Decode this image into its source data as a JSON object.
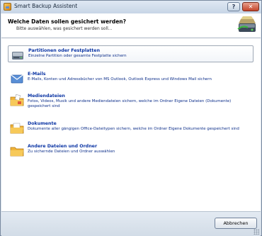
{
  "window": {
    "title": "Smart Backup Assistent",
    "help_label": "?",
    "close_label": "✕"
  },
  "header": {
    "title": "Welche Daten sollen gesichert werden?",
    "subtitle": "Bitte auswählen, was gesichert werden soll..."
  },
  "options": [
    {
      "title": "Partitionen oder Festplatten",
      "description": "Einzelne Partition oder gesamte Festplatte sichern",
      "icon": "hard-drive-icon",
      "selected": true
    },
    {
      "title": "E-Mails",
      "description": "E-Mails, Konten und Adressbücher von MS Outlook, Outlook Express und Windows Mail sichern",
      "icon": "envelope-icon",
      "selected": false
    },
    {
      "title": "Mediendateien",
      "description": "Fotos, Videos, Musik und andere Mediendateien sichern, welche im Ordner Eigene Dateien (Dokumente) gespeichert sind",
      "icon": "media-folder-icon",
      "selected": false
    },
    {
      "title": "Dokumente",
      "description": "Dokumente aller gängigen Office-Dateitypen sichern, welche im Ordner Eigene Dokumente gespeichert sind",
      "icon": "documents-folder-icon",
      "selected": false
    },
    {
      "title": "Andere Dateien und Ordner",
      "description": "Zu sichernde Dateien und Ordner auswählen",
      "icon": "folder-icon",
      "selected": false
    }
  ],
  "footer": {
    "cancel_label": "Abbrechen"
  },
  "colors": {
    "link_blue": "#0b35a4",
    "header_bg": "#ffffff",
    "chrome_bg": "#dfe6ee"
  }
}
